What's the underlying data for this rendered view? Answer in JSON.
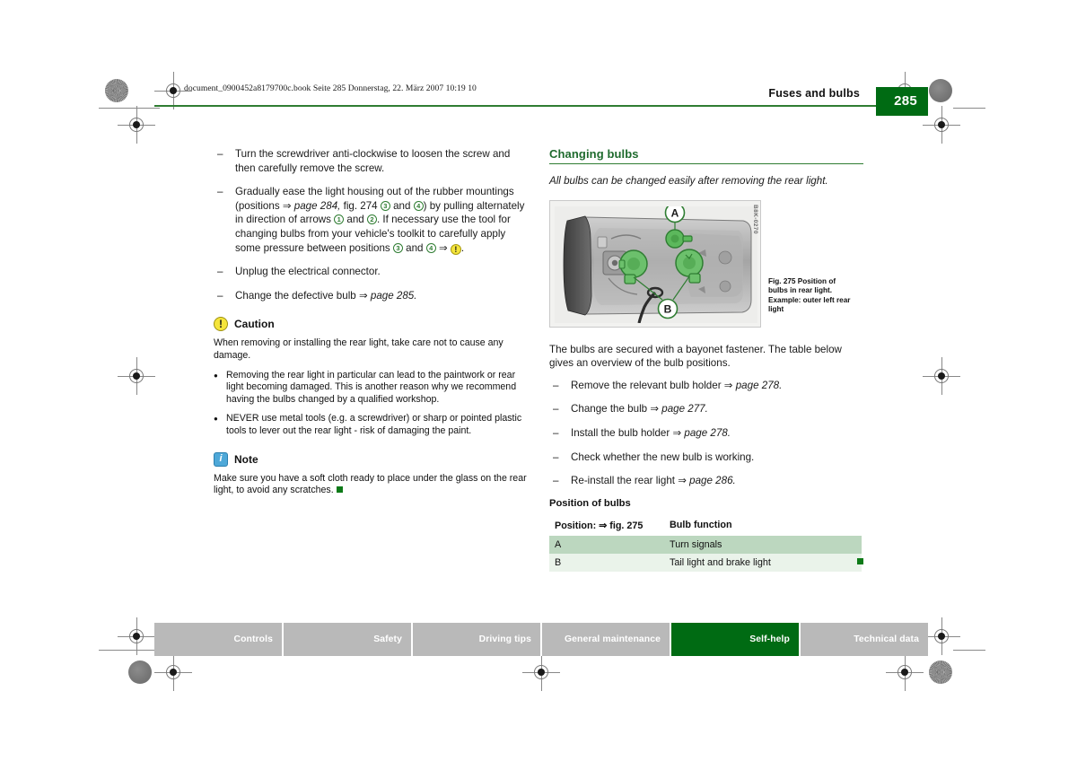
{
  "print_meta": {
    "file_line": "document_0900452a8179700c.book  Seite 285  Donnerstag, 22. März 2007  10:19 10"
  },
  "header": {
    "title": "Fuses and bulbs",
    "page_number": "285",
    "rule_color": "#2f7d32",
    "page_box_color": "#006b13"
  },
  "left_column": {
    "steps": [
      {
        "parts": [
          {
            "t": "text",
            "v": "Turn the screwdriver anti-clockwise to loosen the screw and then carefully remove the screw."
          }
        ]
      },
      {
        "parts": [
          {
            "t": "text",
            "v": "Gradually ease the light housing out of the rubber mountings (positions "
          },
          {
            "t": "arrow",
            "v": "⇒"
          },
          {
            "t": "italic",
            "v": " page 284,"
          },
          {
            "t": "text",
            "v": " fig. 274 "
          },
          {
            "t": "cnum",
            "v": "3"
          },
          {
            "t": "text",
            "v": " and "
          },
          {
            "t": "cnum",
            "v": "4"
          },
          {
            "t": "text",
            "v": ") by pulling alternately in direction of arrows "
          },
          {
            "t": "cnum",
            "v": "1"
          },
          {
            "t": "text",
            "v": " and "
          },
          {
            "t": "cnum",
            "v": "2"
          },
          {
            "t": "text",
            "v": ". If necessary use the tool for changing bulbs from your vehicle's toolkit to carefully apply some pressure between positions "
          },
          {
            "t": "cnum",
            "v": "3"
          },
          {
            "t": "text",
            "v": " and "
          },
          {
            "t": "cnum",
            "v": "4"
          },
          {
            "t": "text",
            "v": " "
          },
          {
            "t": "arrow",
            "v": "⇒"
          },
          {
            "t": "text",
            "v": " "
          },
          {
            "t": "warn",
            "v": "!"
          },
          {
            "t": "text",
            "v": "."
          }
        ]
      },
      {
        "parts": [
          {
            "t": "text",
            "v": "Unplug the electrical connector."
          }
        ]
      },
      {
        "parts": [
          {
            "t": "text",
            "v": "Change the defective bulb "
          },
          {
            "t": "arrow",
            "v": "⇒"
          },
          {
            "t": "italic",
            "v": " page 285."
          }
        ]
      }
    ],
    "caution": {
      "icon": "caution-icon",
      "icon_glyph": "!",
      "label": "Caution",
      "intro": "When removing or installing the rear light, take care not to cause any damage.",
      "bullets": [
        "Removing the rear light in particular can lead to the paintwork or rear light becoming damaged. This is another reason why we recommend having the bulbs changed by a qualified workshop.",
        "NEVER use metal tools (e.g. a screwdriver) or sharp or pointed plastic tools to lever out the rear light - risk of damaging the paint."
      ]
    },
    "note": {
      "icon": "info-icon",
      "icon_glyph": "i",
      "label": "Note",
      "text": "Make sure you have a soft cloth ready to place under the glass on the rear light, to avoid any scratches."
    }
  },
  "right_column": {
    "heading": "Changing bulbs",
    "lead": "All bulbs can be changed easily after removing the rear light.",
    "figure": {
      "code": "B8K-0270",
      "callout_a": "A",
      "callout_b": "B",
      "caption_line1": "Fig. 275   Position of",
      "caption_line2": "bulbs in rear light.",
      "caption_line3": "Example: outer left rear",
      "caption_line4": "light"
    },
    "intro": "The bulbs are secured with a bayonet fastener. The table below gives an overview of the bulb positions.",
    "steps": [
      {
        "parts": [
          {
            "t": "text",
            "v": "Remove the relevant bulb holder "
          },
          {
            "t": "arrow",
            "v": "⇒"
          },
          {
            "t": "italic",
            "v": " page 278."
          }
        ]
      },
      {
        "parts": [
          {
            "t": "text",
            "v": "Change the bulb "
          },
          {
            "t": "arrow",
            "v": "⇒"
          },
          {
            "t": "italic",
            "v": " page 277."
          }
        ]
      },
      {
        "parts": [
          {
            "t": "text",
            "v": "Install the bulb holder "
          },
          {
            "t": "arrow",
            "v": "⇒"
          },
          {
            "t": "italic",
            "v": " page 278."
          }
        ]
      },
      {
        "parts": [
          {
            "t": "text",
            "v": "Check whether the new bulb is working."
          }
        ]
      },
      {
        "parts": [
          {
            "t": "text",
            "v": "Re-install the rear light "
          },
          {
            "t": "arrow",
            "v": "⇒"
          },
          {
            "t": "italic",
            "v": " page 286."
          }
        ]
      }
    ],
    "table": {
      "title": "Position of bulbs",
      "columns": [
        "Position: ⇒ fig. 275",
        "Bulb function"
      ],
      "rows": [
        {
          "position": "A",
          "function": "Turn signals"
        },
        {
          "position": "B",
          "function": "Tail light and brake light"
        }
      ],
      "header_bg": "#ffffff",
      "row_a_bg": "#bcd7bf",
      "row_b_bg": "#eaf3ea"
    }
  },
  "footer_nav": {
    "tabs": [
      {
        "label": "Controls",
        "active": false
      },
      {
        "label": "Safety",
        "active": false
      },
      {
        "label": "Driving tips",
        "active": false
      },
      {
        "label": "General maintenance",
        "active": false
      },
      {
        "label": "Self-help",
        "active": true
      },
      {
        "label": "Technical data",
        "active": false
      }
    ],
    "inactive_bg": "#b9b9b9",
    "active_bg": "#006b13"
  }
}
